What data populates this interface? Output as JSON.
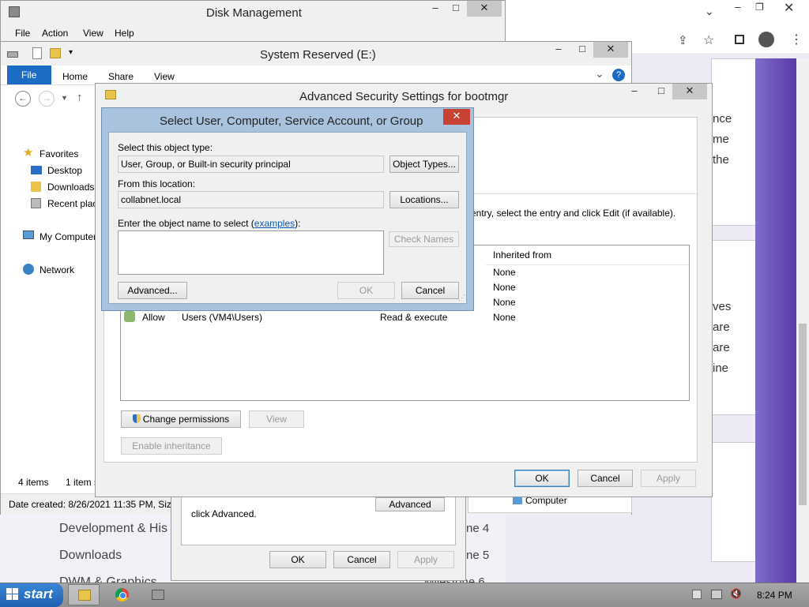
{
  "browser": {
    "right_lines_1": [
      "nce",
      "me",
      "the"
    ],
    "right_lines_2": [
      "ves",
      "are",
      "are",
      "ine"
    ]
  },
  "disk_mgmt": {
    "title": "Disk Management",
    "menu": [
      "File",
      "Action",
      "View",
      "Help"
    ]
  },
  "explorer": {
    "title": "System Reserved (E:)",
    "ribbon_tabs": [
      "File",
      "Home",
      "Share",
      "View"
    ],
    "nav": {
      "favorites": "Favorites",
      "desktop": "Desktop",
      "downloads": "Downloads",
      "recent": "Recent plac",
      "my_computer": "My Computer",
      "network": "Network"
    },
    "status_items": "4 items",
    "status_selected": "1 item s",
    "date_created": "Date created: 8/26/2021 11:35 PM, Size:"
  },
  "background_dialog": {
    "text": "click Advanced.",
    "advanced_button": "Advanced",
    "computer_label": "Computer",
    "ok": "OK",
    "cancel": "Cancel",
    "apply": "Apply"
  },
  "behind_list": {
    "items": [
      "Development & His",
      "Downloads",
      "DWM & Graphics"
    ],
    "milestones": [
      "ne 4",
      "ne 5",
      "Milestone 6"
    ]
  },
  "adv_security": {
    "title": "Advanced Security Settings for bootmgr",
    "instruction": "entry, select the entry and click Edit (if available).",
    "col_inherited": "Inherited from",
    "rows": [
      {
        "type": "",
        "principal": "",
        "access": "",
        "inherited": "None"
      },
      {
        "type": "",
        "principal": "",
        "access": "",
        "inherited": "None"
      },
      {
        "type": "",
        "principal": "",
        "access": "",
        "inherited": "None"
      },
      {
        "type": "Allow",
        "principal": "Users (VM4\\Users)",
        "access": "Read & execute",
        "inherited": "None"
      }
    ],
    "change_permissions": "Change permissions",
    "view": "View",
    "enable_inheritance": "Enable inheritance",
    "ok": "OK",
    "cancel": "Cancel",
    "apply": "Apply"
  },
  "select_dialog": {
    "title": "Select User, Computer, Service Account, or Group",
    "object_type_label": "Select this object type:",
    "object_type_value": "User, Group, or Built-in security principal",
    "object_types_button": "Object Types...",
    "location_label": "From this location:",
    "location_value": "collabnet.local",
    "locations_button": "Locations...",
    "enter_label_prefix": "Enter the object name to select (",
    "enter_label_link": "examples",
    "enter_label_suffix": "):",
    "object_name_value": "",
    "check_names": "Check Names",
    "advanced": "Advanced...",
    "ok": "OK",
    "cancel": "Cancel"
  },
  "taskbar": {
    "start": "start",
    "clock": "8:24 PM"
  }
}
